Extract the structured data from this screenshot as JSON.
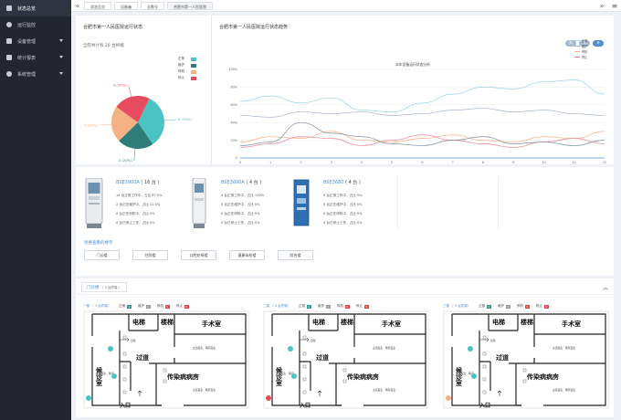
{
  "sidebar": {
    "items": [
      {
        "label": "状态总览",
        "active": true
      },
      {
        "label": "运行监控",
        "active": false
      },
      {
        "label": "设备管理",
        "active": false,
        "expandable": true
      },
      {
        "label": "统计报表",
        "active": false,
        "expandable": true
      },
      {
        "label": "系统管理",
        "active": false,
        "expandable": true
      }
    ]
  },
  "topbar": {
    "tabs": [
      "状态总览",
      "设备箱",
      "总数号",
      "合肥市第一人民医院"
    ],
    "prev_icon": "double-chevron-left-icon",
    "next_icon": "double-chevron-right-icon"
  },
  "status_panel": {
    "title": "合肥市第一人民医院运行状态",
    "subtitle": "全院共计有 20 台终端",
    "legend": [
      {
        "label": "正常",
        "color": "#4cc3c3"
      },
      {
        "label": "维护",
        "color": "#2e7d7a"
      },
      {
        "label": "停机",
        "color": "#f4b183"
      },
      {
        "label": "停止",
        "color": "#e84a5f"
      }
    ],
    "chart_data": {
      "type": "pie",
      "slices": [
        {
          "label": "正常",
          "value": 30,
          "color": "#4cc3c3",
          "text": "6 (30%)"
        },
        {
          "label": "维护",
          "value": 20,
          "color": "#2e7d7a",
          "text": "4 (20%)"
        },
        {
          "label": "停机",
          "value": 20,
          "color": "#f4b183",
          "text": "4 (20%)"
        },
        {
          "label": "停止",
          "value": 20,
          "color": "#e84a5f",
          "text": "4 (20%)"
        }
      ]
    }
  },
  "trend_panel": {
    "title": "合肥市第一人民医院运行状态趋势",
    "buttons": [
      "周",
      "月",
      "年"
    ],
    "chart_data": {
      "type": "line",
      "title": "本年设备运行状态分析",
      "x": [
        0,
        1,
        2,
        3,
        4,
        5,
        6,
        7,
        8,
        9,
        10,
        11,
        12
      ],
      "ylim": [
        0,
        100
      ],
      "yticks": [
        "0",
        "20%",
        "40%",
        "60%",
        "80%",
        "100%"
      ],
      "series": [
        {
          "name": "正常",
          "color": "#9cd3e8",
          "values": [
            64,
            70,
            62,
            68,
            54,
            52,
            62,
            72,
            80,
            78,
            86,
            88,
            72
          ]
        },
        {
          "name": "维护",
          "color": "#a6b4c8",
          "values": [
            48,
            46,
            52,
            50,
            52,
            48,
            50,
            54,
            56,
            52,
            54,
            50,
            48
          ]
        },
        {
          "name": "停机",
          "color": "#f4b183",
          "values": [
            18,
            24,
            22,
            30,
            20,
            18,
            22,
            26,
            20,
            18,
            24,
            22,
            30
          ]
        },
        {
          "name": "停止",
          "color": "#e8848f",
          "values": [
            12,
            16,
            24,
            22,
            14,
            20,
            26,
            20,
            16,
            12,
            18,
            22,
            16
          ]
        },
        {
          "name": "",
          "color": "#7a8a9a",
          "values": [
            14,
            18,
            40,
            28,
            24,
            16,
            14,
            20,
            24,
            16,
            18,
            14,
            20
          ]
        }
      ]
    }
  },
  "devices": [
    {
      "name": "BSE3900A",
      "count": "( 16 台 )",
      "lines": [
        "14 台正常工作中，占比 87.5%",
        "2 台正在维护中，占比 12.5%",
        "0 台正在停机中，占比 0%",
        "0 台已停止工作，占比 0%"
      ]
    },
    {
      "name": "BSE3600A",
      "count": "( 4 台 )",
      "lines": [
        "4 台正常工作中，占比 100%",
        "0 台正在维护中，占比 0%",
        "0 台正在停机中，占比 0%",
        "0 台已停止工作，占比 0%"
      ]
    },
    {
      "name": "BSE3680",
      "count": "( 4 台 )",
      "lines": [
        "0 台正常工作中，占比 0%",
        "0 台正在维护中，占比 0%",
        "0 台正在停机中，占比 0%",
        "4 台已停止工作，占比 0%"
      ]
    }
  ],
  "wards": {
    "title": "另要查看的楼宇",
    "buttons": [
      "门诊楼",
      "住院楼",
      "口腔轮椅楼",
      "健康体检楼",
      "综合楼"
    ]
  },
  "building": {
    "tab": "门诊楼",
    "tab_count": "（ 3 台终端 ）",
    "plans": [
      {
        "title": "一楼 （ 3 台终端）",
        "stats": [
          {
            "label": "正常",
            "value": "2"
          },
          {
            "label": "维护",
            "value": "0"
          },
          {
            "label": "停机",
            "value": "1"
          },
          {
            "label": "停止",
            "value": "0"
          }
        ],
        "rooms": {
          "elevator": "电梯",
          "stairs": "楼梯",
          "surgery": "手术室",
          "clinic": "候诊室",
          "corridor": "过道",
          "infect": "传染病病房",
          "entrance": "入口",
          "outbound": "出院",
          "staff1": "正常医生：略况",
          "staff2": "主治医生：略有医生",
          "staff3": "主任医生：略有医生"
        },
        "marks": [
          "#4cc3c3",
          "#4cc3c3",
          "#4cc3c3"
        ]
      },
      {
        "title": "二楼 （ 3 台终端）",
        "stats": [
          {
            "label": "正常",
            "value": "2"
          },
          {
            "label": "维护",
            "value": "0"
          },
          {
            "label": "停机",
            "value": "0"
          },
          {
            "label": "停止",
            "value": "1"
          }
        ],
        "rooms": {
          "elevator": "电梯",
          "stairs": "楼梯",
          "surgery": "手术室",
          "clinic": "候诊室",
          "corridor": "过道",
          "infect": "传染病病房",
          "entrance": "入口",
          "outbound": "出院",
          "staff1": "正常医生：略况",
          "staff2": "主治医生：略有医生",
          "staff3": "主任医生：略有医生"
        },
        "marks": [
          "#4cc3c3",
          "#4cc3c3",
          "#e84a5f"
        ]
      },
      {
        "title": "三楼 （ 3 台终端）",
        "stats": [
          {
            "label": "正常",
            "value": "2"
          },
          {
            "label": "维护",
            "value": "0"
          },
          {
            "label": "停机",
            "value": "1"
          },
          {
            "label": "停止",
            "value": "0"
          }
        ],
        "rooms": {
          "elevator": "电梯",
          "stairs": "楼梯",
          "surgery": "手术室",
          "clinic": "候诊室",
          "corridor": "过道",
          "infect": "传染病病房",
          "entrance": "入口",
          "outbound": "出院",
          "staff1": "正常医生：略况",
          "staff2": "主治医生：略有医生",
          "staff3": "主任医生：略有医生"
        },
        "marks": [
          "#4cc3c3",
          "#4cc3c3",
          "#f4b183"
        ]
      }
    ]
  }
}
